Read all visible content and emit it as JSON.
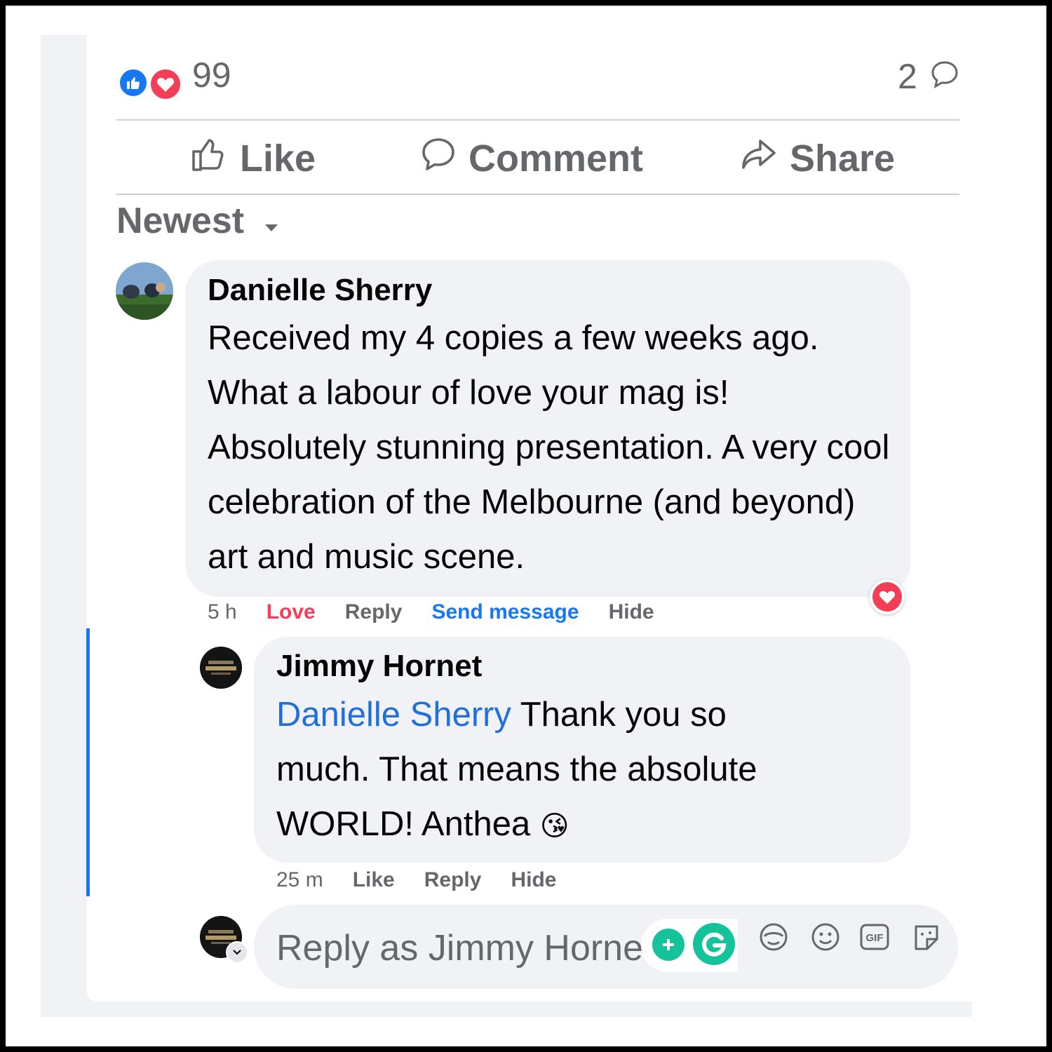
{
  "reactions": {
    "count": "99",
    "types": [
      "like",
      "love"
    ]
  },
  "comments_count": "2",
  "actions": {
    "like": "Like",
    "comment": "Comment",
    "share": "Share"
  },
  "sort": {
    "label": "Newest"
  },
  "comments": [
    {
      "author": "Danielle Sherry",
      "text": "Received my 4 copies a few weeks ago. What a labour of love your mag is! Absolutely stunning presentation. A very cool celebration of the Melbourne (and beyond) art and music scene.",
      "time": "5 h",
      "love": "Love",
      "reply": "Reply",
      "send_message": "Send message",
      "hide": "Hide",
      "reaction": "love"
    },
    {
      "author": "Jimmy Hornet",
      "mention": "Danielle Sherry",
      "text_line1": "Thank you so",
      "text_line2": "much. That means the absolute",
      "text_line3": "WORLD! Anthea",
      "emoji": "😘",
      "time": "25 m",
      "like": "Like",
      "reply": "Reply",
      "hide": "Hide"
    }
  ],
  "reply_box": {
    "placeholder": "Reply as Jimmy Hornet"
  },
  "colors": {
    "accent": "#1877f2",
    "love": "#f33e58",
    "grammarly": "#15c39a"
  }
}
